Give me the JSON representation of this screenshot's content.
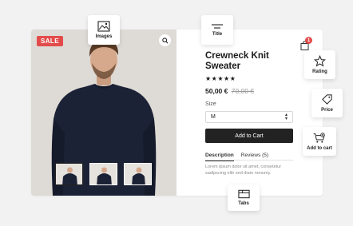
{
  "product": {
    "badge": "SALE",
    "title": "Crewneck Knit Sweater",
    "rating_stars": "★★★★★",
    "rating_value": 5,
    "price": "50,00 €",
    "old_price": "70,00 €",
    "size_label": "Size",
    "size_value": "M",
    "add_to_cart_label": "Add to Cart",
    "tabs": [
      "Description",
      "Reviews (5)"
    ],
    "description": "Lorem ipsum dolor sit amet, consetetur sadipscing elitr sed diam nonumy."
  },
  "cart": {
    "count": "1"
  },
  "tiles": {
    "images": "Images",
    "title": "Title",
    "rating": "Rating",
    "price": "Price",
    "add_to_cart": "Add to cart",
    "tabs": "Tabs"
  },
  "colors": {
    "sale": "#e34b4b",
    "button": "#222222",
    "sweater": "#1c2236",
    "background": "#f2f2f3"
  },
  "icons": [
    "search-icon",
    "shopping-bag-icon",
    "image-icon",
    "title-icon",
    "star-icon",
    "price-tag-icon",
    "cart-add-icon",
    "tabs-icon"
  ]
}
